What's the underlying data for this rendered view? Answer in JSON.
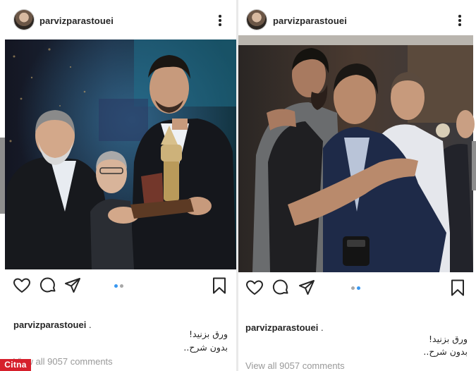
{
  "posts": [
    {
      "username": "parvizparastouei",
      "caption_user": "parvizparastouei",
      "caption_dot": " .",
      "caption_lines": [
        "ورق بزنید!",
        "بدون شرح.."
      ],
      "view_all_comments": "View all 9057 comments",
      "carousel": {
        "current": 1,
        "total": 2
      },
      "icons": [
        "heart-icon",
        "comment-icon",
        "share-icon",
        "bookmark-icon",
        "more-options-icon"
      ]
    },
    {
      "username": "parvizparastouei",
      "caption_user": "parvizparastouei",
      "caption_dot": " .",
      "caption_lines": [
        "ورق بزنید!",
        "بدون شرح.."
      ],
      "view_all_comments": "View all 9057 comments",
      "carousel": {
        "current": 2,
        "total": 2
      },
      "icons": [
        "heart-icon",
        "comment-icon",
        "share-icon",
        "bookmark-icon",
        "more-options-icon"
      ]
    }
  ],
  "watermark": "Citna",
  "colors": {
    "carousel_active": "#3897f0",
    "watermark": "#d6202c",
    "text": "#262626",
    "muted": "#999999"
  }
}
